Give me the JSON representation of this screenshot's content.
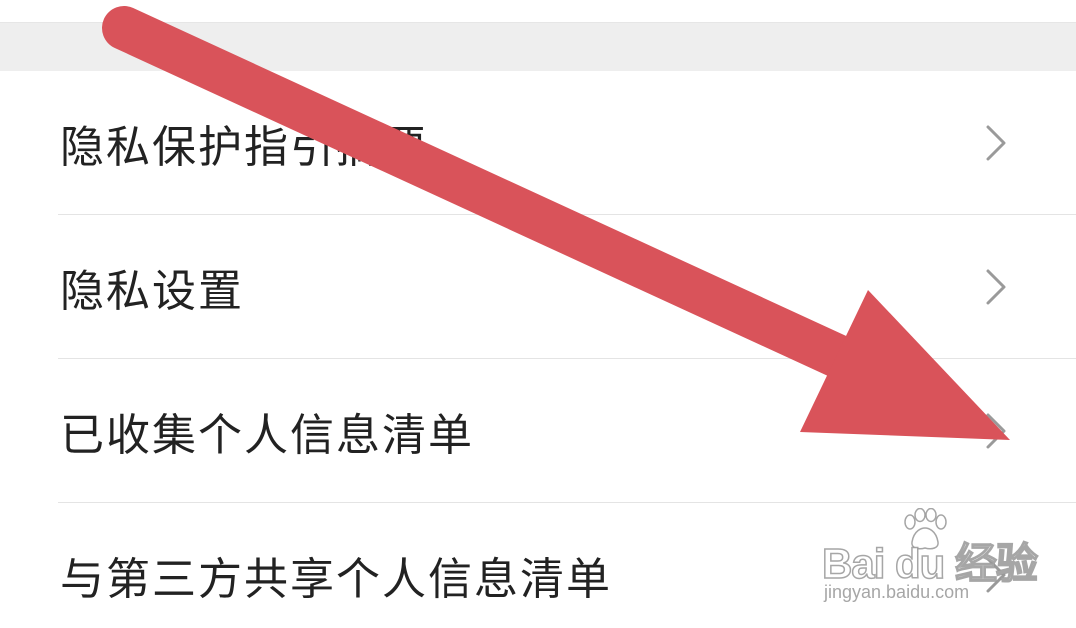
{
  "menu": {
    "items": [
      {
        "label": "隐私保护指引摘要",
        "icon": "chevron-right-icon"
      },
      {
        "label": "隐私设置",
        "icon": "chevron-right-icon"
      },
      {
        "label": "已收集个人信息清单",
        "icon": "chevron-right-icon"
      },
      {
        "label": "与第三方共享个人信息清单",
        "icon": "chevron-right-icon"
      }
    ]
  },
  "annotation": {
    "icon": "arrow-annotation-icon",
    "color": "#d9535a"
  },
  "watermark": {
    "brand": "Bai du 经验",
    "domain": "jingyan.baidu.com",
    "icon": "paw-logo-icon"
  },
  "colors": {
    "background": "#ffffff",
    "section_gap": "#eeeeee",
    "divider": "#e4e4e4",
    "text": "#222222",
    "chevron": "#9a9a9a"
  }
}
